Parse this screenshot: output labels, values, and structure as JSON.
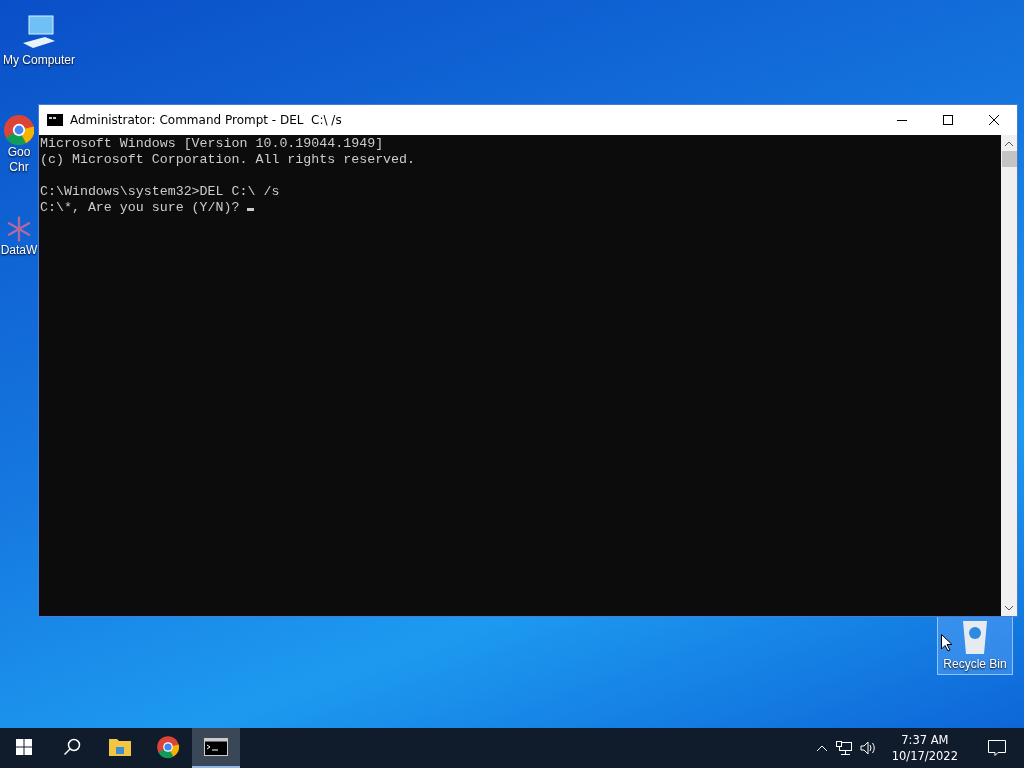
{
  "desktop_icons": [
    {
      "kind": "computer",
      "lines": [
        "My Computer"
      ],
      "selected": false
    },
    {
      "kind": "chrome",
      "lines": [
        "Goo",
        "Chr"
      ],
      "selected": false
    },
    {
      "kind": "app",
      "lines": [
        "DataW"
      ],
      "selected": false
    },
    {
      "kind": "recycle",
      "lines": [
        "Recycle Bin"
      ],
      "selected": true
    }
  ],
  "window": {
    "title": "Administrator: Command Prompt - DEL  C:\\ /s",
    "console": {
      "blocks": [
        [
          "Microsoft Windows [Version 10.0.19044.1949]",
          "(c) Microsoft Corporation. All rights reserved."
        ],
        [
          "C:\\Windows\\system32>DEL C:\\ /s",
          "C:\\*, Are you sure (Y/N)? "
        ]
      ],
      "cursor": true
    }
  },
  "taskbar": {
    "apps": [
      {
        "kind": "start",
        "selected": false
      },
      {
        "kind": "search",
        "selected": false
      },
      {
        "kind": "explorer",
        "selected": false
      },
      {
        "kind": "chrome",
        "selected": false
      },
      {
        "kind": "cmd",
        "selected": true
      }
    ],
    "clock": {
      "time": "7:37 AM",
      "date": "10/17/2022"
    }
  }
}
